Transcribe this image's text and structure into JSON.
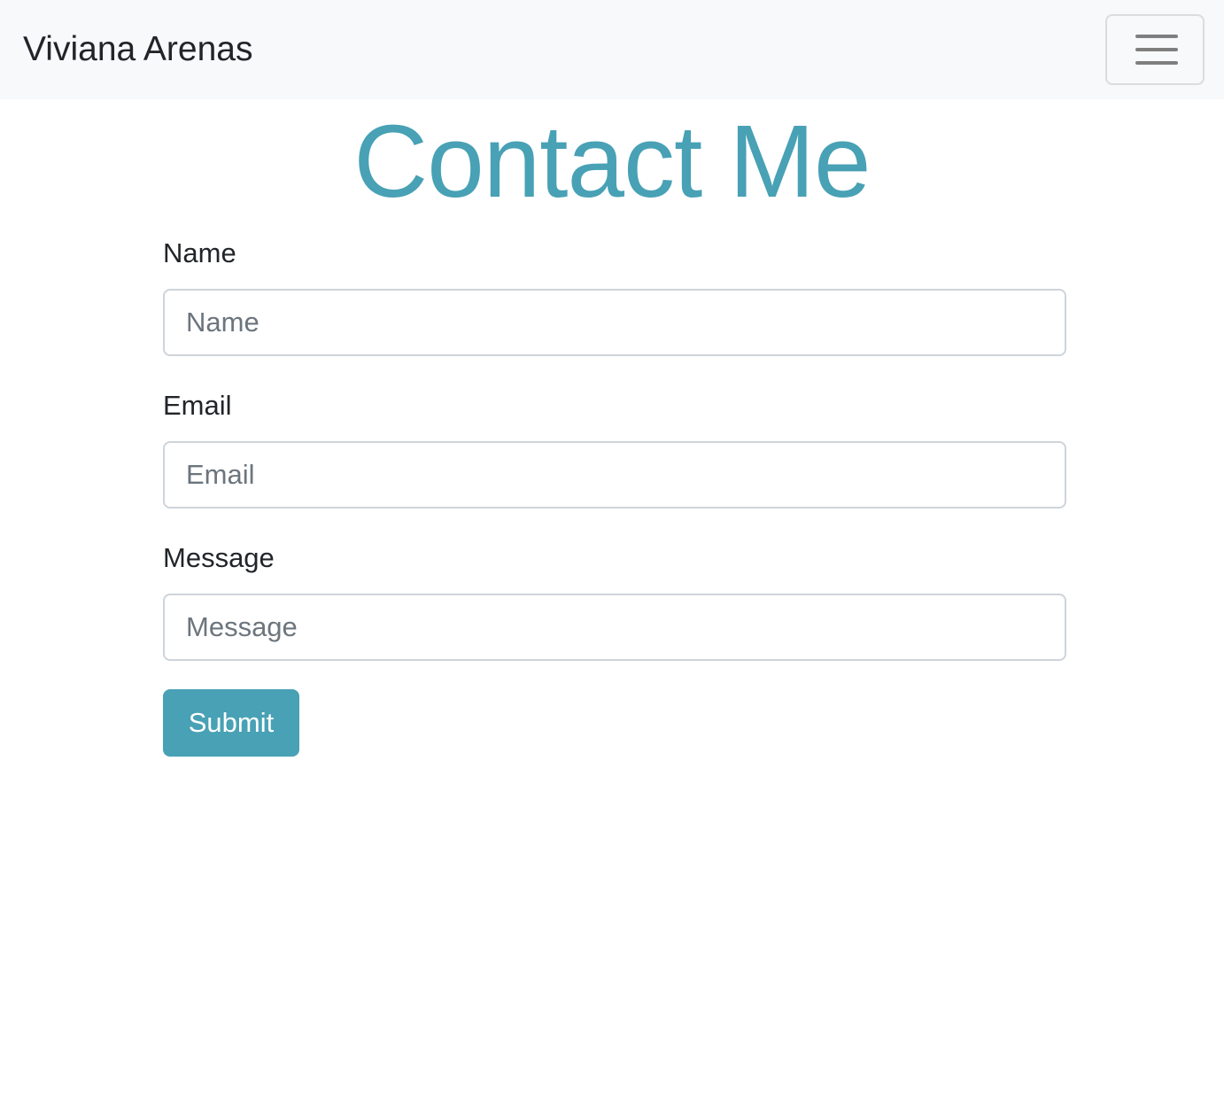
{
  "navbar": {
    "brand": "Viviana Arenas",
    "toggler_icon": "hamburger-menu-icon"
  },
  "page": {
    "title": "Contact Me"
  },
  "form": {
    "name": {
      "label": "Name",
      "placeholder": "Name",
      "value": ""
    },
    "email": {
      "label": "Email",
      "placeholder": "Email",
      "value": ""
    },
    "message": {
      "label": "Message",
      "placeholder": "Message",
      "value": ""
    },
    "submit_label": "Submit"
  },
  "colors": {
    "accent": "#48a1b5",
    "navbar_bg": "#f8f9fa",
    "text": "#212529",
    "placeholder": "#6c757d"
  }
}
